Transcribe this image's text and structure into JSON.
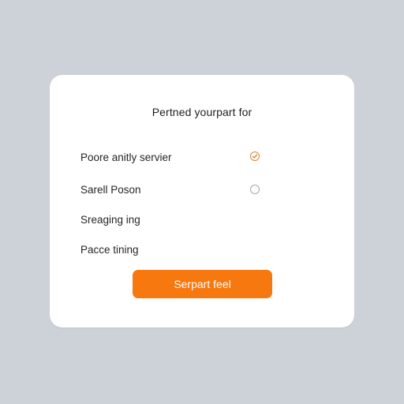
{
  "card": {
    "title": "Pertned yourpart for",
    "options": [
      {
        "label": "Poore anitly servier",
        "selected": true
      },
      {
        "label": "Sarell Poson",
        "selected": false
      },
      {
        "label": "Sreaging ing"
      },
      {
        "label": "Pacce tining"
      }
    ],
    "submit_label": "Serpart feel"
  },
  "colors": {
    "background": "#cdd2d8",
    "card": "#ffffff",
    "accent": "#f7780f",
    "radio_checked": "#d9883a",
    "radio_unchecked": "#a7a7a7"
  },
  "icons": {
    "selected_radio": "check-circle-icon",
    "unselected_radio": "empty-circle-icon"
  }
}
